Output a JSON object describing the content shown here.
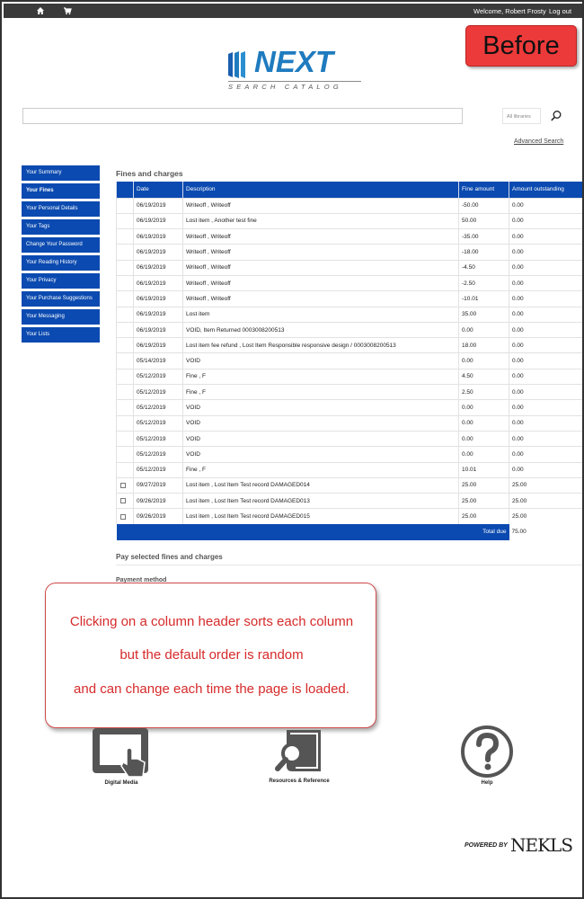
{
  "topbar": {
    "home_icon": "home-icon",
    "cart_icon": "cart-icon",
    "welcome": "Welcome, Robert Frosty",
    "logout": "Log out"
  },
  "badge": {
    "label": "Before",
    "color": "#ec3a3a"
  },
  "logo": {
    "word": "NEXT",
    "sub": "SEARCH CATALOG"
  },
  "search": {
    "value": "",
    "libraries": "All libraries",
    "search_icon": "search-icon",
    "advanced": "Advanced Search"
  },
  "sidebar": {
    "items": [
      {
        "label": "Your Summary"
      },
      {
        "label": "Your Fines"
      },
      {
        "label": "Your Personal Details"
      },
      {
        "label": "Your Tags"
      },
      {
        "label": "Change Your Password"
      },
      {
        "label": "Your Reading History"
      },
      {
        "label": "Your Privacy"
      },
      {
        "label": "Your Purchase Suggestions"
      },
      {
        "label": "Your Messaging"
      },
      {
        "label": "Your Lists"
      }
    ]
  },
  "fines": {
    "title": "Fines and charges",
    "columns": [
      "",
      "Date",
      "Description",
      "Fine amount",
      "Amount outstanding"
    ],
    "rows": [
      {
        "checkbox": false,
        "date": "06/19/2019",
        "description": "Writeoff , Writeoff",
        "fine": "-50.00",
        "outstanding": "0.00"
      },
      {
        "checkbox": false,
        "date": "06/19/2019",
        "description": "Lost item , Another test fine",
        "fine": "50.00",
        "outstanding": "0.00"
      },
      {
        "checkbox": false,
        "date": "06/19/2019",
        "description": "Writeoff , Writeoff",
        "fine": "-35.00",
        "outstanding": "0.00"
      },
      {
        "checkbox": false,
        "date": "06/19/2019",
        "description": "Writeoff , Writeoff",
        "fine": "-18.00",
        "outstanding": "0.00"
      },
      {
        "checkbox": false,
        "date": "06/19/2019",
        "description": "Writeoff , Writeoff",
        "fine": "-4.50",
        "outstanding": "0.00"
      },
      {
        "checkbox": false,
        "date": "06/19/2019",
        "description": "Writeoff , Writeoff",
        "fine": "-2.50",
        "outstanding": "0.00"
      },
      {
        "checkbox": false,
        "date": "06/19/2019",
        "description": "Writeoff , Writeoff",
        "fine": "-10.01",
        "outstanding": "0.00"
      },
      {
        "checkbox": false,
        "date": "06/19/2019",
        "description": "Lost item",
        "fine": "35.00",
        "outstanding": "0.00"
      },
      {
        "checkbox": false,
        "date": "06/19/2019",
        "description": "VOID, Item Returned 0003008200513",
        "fine": "0.00",
        "outstanding": "0.00"
      },
      {
        "checkbox": false,
        "date": "06/19/2019",
        "description": "Lost item fee refund , Lost Item Responsible responsive design / 0003008200513",
        "fine": "18.00",
        "outstanding": "0.00"
      },
      {
        "checkbox": false,
        "date": "05/14/2019",
        "description": "VOID",
        "fine": "0.00",
        "outstanding": "0.00"
      },
      {
        "checkbox": false,
        "date": "05/12/2019",
        "description": "Fine , F",
        "fine": "4.50",
        "outstanding": "0.00"
      },
      {
        "checkbox": false,
        "date": "05/12/2019",
        "description": "Fine , F",
        "fine": "2.50",
        "outstanding": "0.00"
      },
      {
        "checkbox": false,
        "date": "05/12/2019",
        "description": "VOID",
        "fine": "0.00",
        "outstanding": "0.00"
      },
      {
        "checkbox": false,
        "date": "05/12/2019",
        "description": "VOID",
        "fine": "0.00",
        "outstanding": "0.00"
      },
      {
        "checkbox": false,
        "date": "05/12/2019",
        "description": "VOID",
        "fine": "0.00",
        "outstanding": "0.00"
      },
      {
        "checkbox": false,
        "date": "05/12/2019",
        "description": "VOID",
        "fine": "0.00",
        "outstanding": "0.00"
      },
      {
        "checkbox": false,
        "date": "05/12/2019",
        "description": "Fine , F",
        "fine": "10.01",
        "outstanding": "0.00"
      },
      {
        "checkbox": true,
        "date": "09/27/2019",
        "description": "Lost item , Lost Item Test record DAMAGED014",
        "fine": "25.00",
        "outstanding": "25.00"
      },
      {
        "checkbox": true,
        "date": "09/26/2019",
        "description": "Lost item , Lost Item Test record DAMAGED013",
        "fine": "25.00",
        "outstanding": "25.00"
      },
      {
        "checkbox": true,
        "date": "09/26/2019",
        "description": "Lost item , Lost Item Test record DAMAGED015",
        "fine": "25.00",
        "outstanding": "25.00"
      }
    ],
    "total_label": "Total due",
    "total_value": "75.00"
  },
  "pay": {
    "title": "Pay selected fines and charges",
    "method": "Payment method"
  },
  "callout": {
    "lines": [
      "Clicking on a column header sorts each column",
      "but the default order is random",
      "and can change each time the page is loaded."
    ],
    "color": "#d62a2a"
  },
  "footer_icons": [
    {
      "label": "Digital Media",
      "icon": "tablet-touch-icon"
    },
    {
      "label": "Resources & Reference",
      "icon": "magnifier-book-icon"
    },
    {
      "label": "Help",
      "icon": "question-circle-icon"
    }
  ],
  "powered": {
    "label": "POWERED BY",
    "brand": "NEKLS"
  }
}
